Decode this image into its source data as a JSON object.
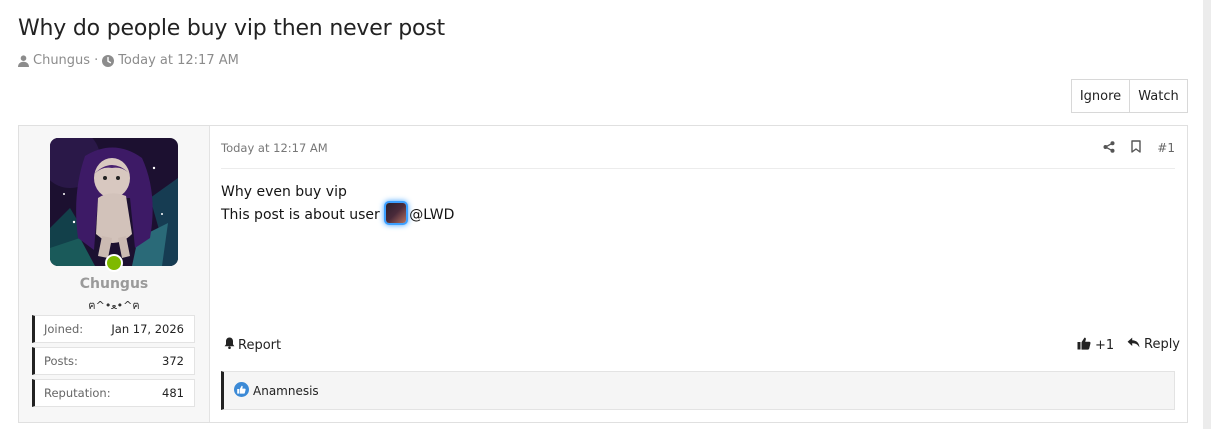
{
  "thread": {
    "title": "Why do people buy vip then never post",
    "author": "Chungus",
    "separator": "·",
    "date": "Today at 12:17 AM",
    "actions": {
      "ignore": "Ignore",
      "watch": "Watch"
    }
  },
  "post": {
    "user": {
      "name": "Chungus",
      "title": "ฅ^•ﻌ•^ฅ",
      "online": true,
      "stats": [
        {
          "label": "Joined:",
          "value": "Jan 17, 2026"
        },
        {
          "label": "Posts:",
          "value": "372"
        },
        {
          "label": "Reputation:",
          "value": "481"
        }
      ]
    },
    "date": "Today at 12:17 AM",
    "number": "#1",
    "lines": {
      "line1": "Why even buy vip",
      "line2_prefix": "This post is about user",
      "mention": "@LWD"
    },
    "footer": {
      "report": "Report",
      "reaction_count": "+1",
      "reply": "Reply"
    },
    "reactions": {
      "user": "Anamnesis"
    }
  },
  "colors": {
    "online": "#7fb900",
    "mention_glow": "#3da0ff",
    "username": "#9a9a9a"
  }
}
